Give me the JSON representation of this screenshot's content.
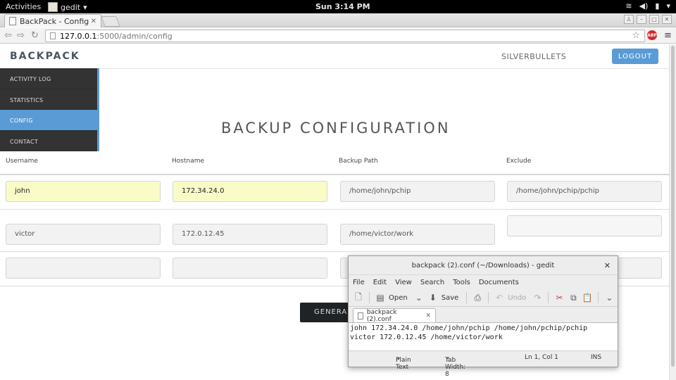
{
  "topbar": {
    "activities": "Activities",
    "app_menu": "gedit",
    "clock": "Sun  3:14 PM"
  },
  "browser": {
    "tab_title": "BackPack - Config",
    "url_host": "127.0.0.1",
    "url_rest": ":5000/admin/config",
    "abp_label": "ABP"
  },
  "app": {
    "brand": "BACKPACK",
    "user": "SILVERBULLETS",
    "logout_label": "LOGOUT",
    "page_title": "BACKUP CONFIGURATION",
    "generate_label": "GENERA"
  },
  "sidebar": {
    "items": [
      {
        "label": "ACTIVITY LOG",
        "active": false
      },
      {
        "label": "STATISTICS",
        "active": false
      },
      {
        "label": "CONFIG",
        "active": true
      },
      {
        "label": "CONTACT",
        "active": false
      }
    ]
  },
  "table": {
    "headers": [
      "Username",
      "Hostname",
      "Backup Path",
      "Exclude"
    ],
    "rows": [
      [
        "john",
        "172.34.24.0",
        "/home/john/pchip",
        "/home/john/pchip/pchip"
      ],
      [
        "victor",
        "172.0.12.45",
        "/home/victor/work",
        ""
      ],
      [
        "",
        "",
        "",
        ""
      ]
    ]
  },
  "gedit": {
    "title": "backpack (2).conf (~/Downloads) - gedit",
    "menu": [
      "File",
      "Edit",
      "View",
      "Search",
      "Tools",
      "Documents"
    ],
    "toolbar": {
      "open": "Open",
      "save": "Save",
      "undo": "Undo"
    },
    "tab_label": "backpack (2).conf",
    "content_line1": "john 172.34.24.0 /home/john/pchip /home/john/pchip/pchip",
    "content_line2": "victor 172.0.12.45 /home/victor/work",
    "status": {
      "syntax": "Plain Text",
      "tab_width": "Tab Width: 8",
      "position": "Ln 1, Col 1",
      "mode": "INS"
    }
  }
}
